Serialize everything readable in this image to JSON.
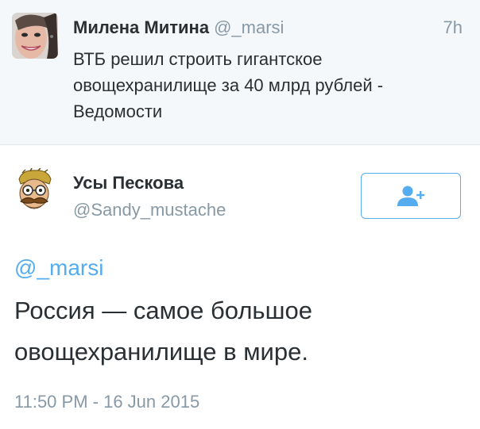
{
  "context_tweet": {
    "author_name": "Милена Митина",
    "author_handle": "@_marsi",
    "time": "7h",
    "text_lines": [
      "ВТБ решил строить гигантское",
      "овощехранилище за 40 млрд рублей -",
      "Ведомости"
    ],
    "avatar_icon": "avatar-photo-icon"
  },
  "main_tweet": {
    "author_name": "Усы Пескова",
    "author_handle": "@Sandy_mustache",
    "follow_icon": "add-user-icon",
    "mention": "@_marsi",
    "text_lines": [
      "Россия — самое большое",
      "овощехранилище в мире."
    ],
    "timestamp": "11:50 PM - 16 Jun 2015",
    "avatar_icon": "cartoon-face-icon"
  },
  "colors": {
    "accent": "#55acee",
    "text": "#292f33",
    "muted": "#8899a6",
    "context_background": "#f5f8fa"
  }
}
